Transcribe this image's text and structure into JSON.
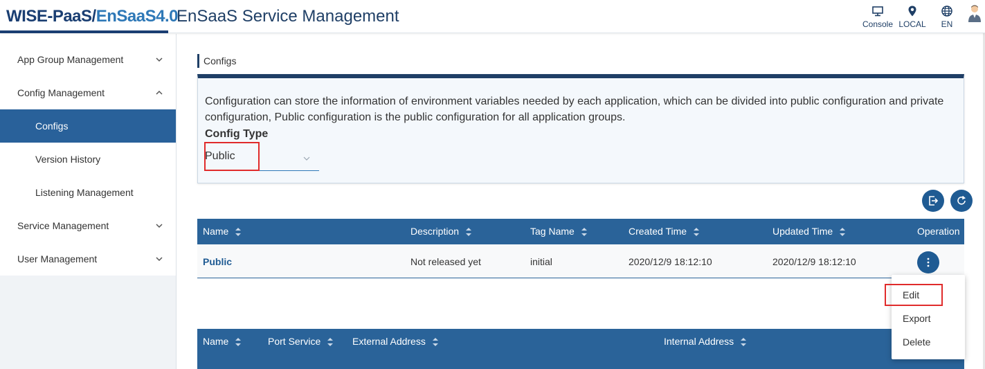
{
  "header": {
    "logo_part1": "WISE-PaaS/",
    "logo_part2": "EnSaaS4.0",
    "app_title": "EnSaaS Service Management",
    "actions": [
      {
        "label": "Console",
        "icon": "monitor-icon"
      },
      {
        "label": "LOCAL",
        "icon": "location-pin-icon"
      },
      {
        "label": "EN",
        "icon": "globe-icon"
      }
    ],
    "user_icon": "user-avatar-icon"
  },
  "sidebar": {
    "items": [
      {
        "label": "App Group Management",
        "expanded": false
      },
      {
        "label": "Config Management",
        "expanded": true
      },
      {
        "label": "Configs",
        "active": true
      },
      {
        "label": "Version History"
      },
      {
        "label": "Listening Management"
      },
      {
        "label": "Service Management",
        "expanded": false
      },
      {
        "label": "User Management",
        "expanded": false
      }
    ]
  },
  "main": {
    "breadcrumb": "Configs",
    "description": "Configuration can store the information of environment variables needed by each application, which can be divided into public configuration and private configuration, Public configuration is the public configuration for all application groups.",
    "config_type_label": "Config Type",
    "config_type_value": "Public",
    "configs_table": {
      "columns": [
        "Name",
        "Description",
        "Tag Name",
        "Created Time",
        "Updated Time",
        "Operation"
      ],
      "rows": [
        {
          "name": "Public",
          "description": "Not released yet",
          "tag": "initial",
          "created": "2020/12/9 18:12:10",
          "updated": "2020/12/9 18:12:10"
        }
      ]
    },
    "operation_menu": [
      "Edit",
      "Export",
      "Delete"
    ],
    "services_table": {
      "columns": [
        "Name",
        "Port Service",
        "External Address",
        "Internal Address"
      ]
    }
  },
  "colors": {
    "accent": "#2a6399",
    "navy": "#1f3f66",
    "highlight": "#e02b2b"
  }
}
